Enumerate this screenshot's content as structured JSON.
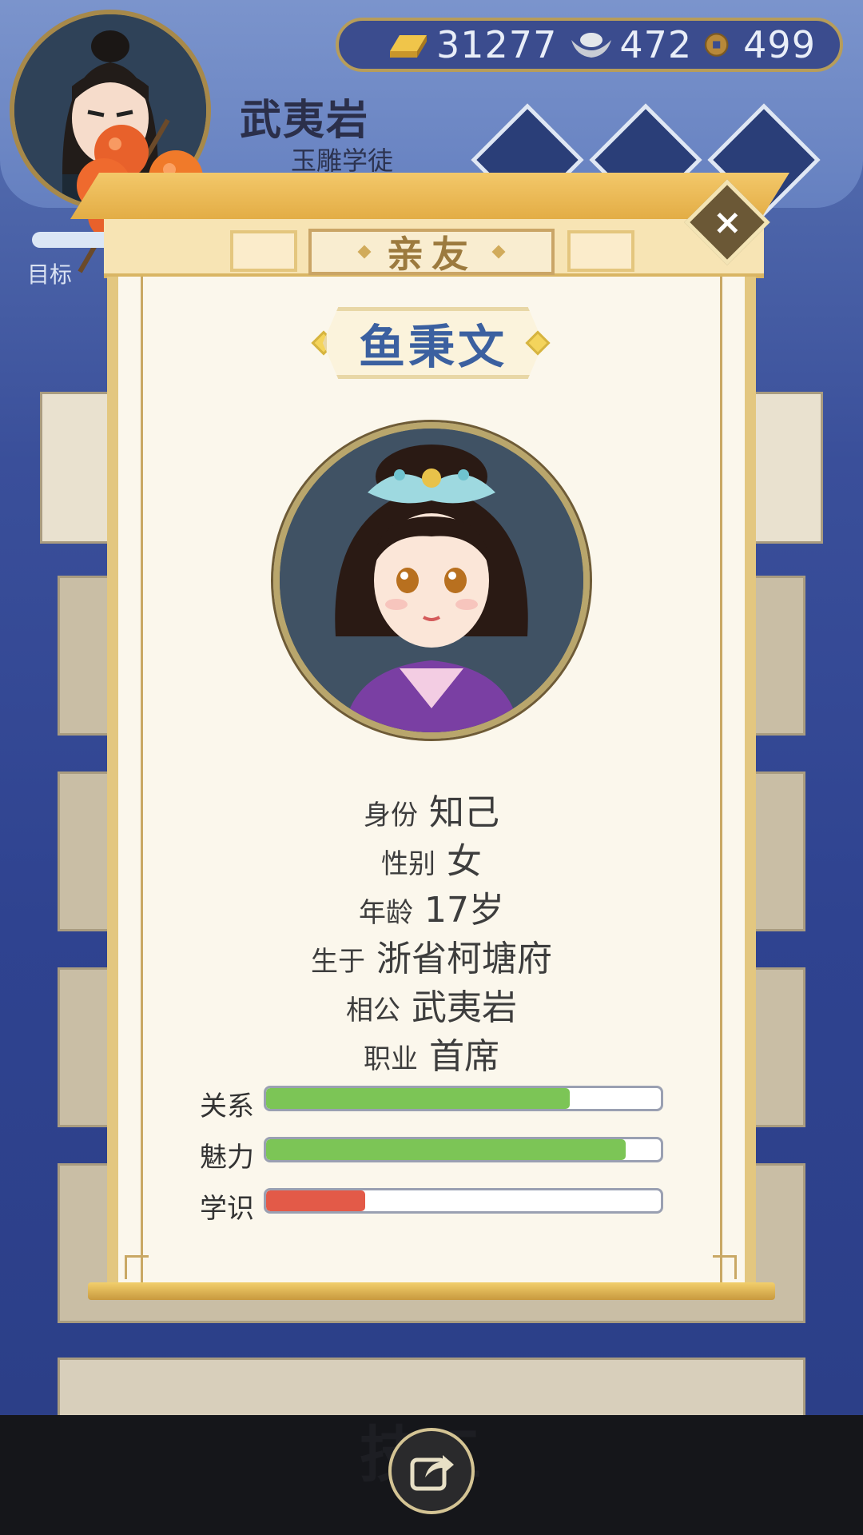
{
  "player": {
    "name": "武夷岩",
    "rank": "玉雕学徒",
    "goal_label": "目标"
  },
  "currency": {
    "gold": "31277",
    "silver": "472",
    "coins": "499"
  },
  "bottom": {
    "title": "技工"
  },
  "modal": {
    "title": "亲友",
    "close_label": "×",
    "character_name": "鱼秉文",
    "info": [
      {
        "key": "身份",
        "value": "知己"
      },
      {
        "key": "性别",
        "value": "女"
      },
      {
        "key": "年龄",
        "value": "17岁"
      },
      {
        "key": "生于",
        "value": "浙省柯塘府"
      },
      {
        "key": "相公",
        "value": "武夷岩"
      },
      {
        "key": "职业",
        "value": "首席"
      }
    ],
    "stats": [
      {
        "label": "关系",
        "percent": 77,
        "color": "#7cc556"
      },
      {
        "label": "魅力",
        "percent": 91,
        "color": "#7cc556"
      },
      {
        "label": "学识",
        "percent": 25,
        "color": "#e35a48"
      }
    ]
  },
  "icons": [
    "gold-ingot-icon",
    "silver-ingot-icon",
    "copper-coin-icon",
    "close-icon",
    "share-icon",
    "tanghulu-icon"
  ]
}
